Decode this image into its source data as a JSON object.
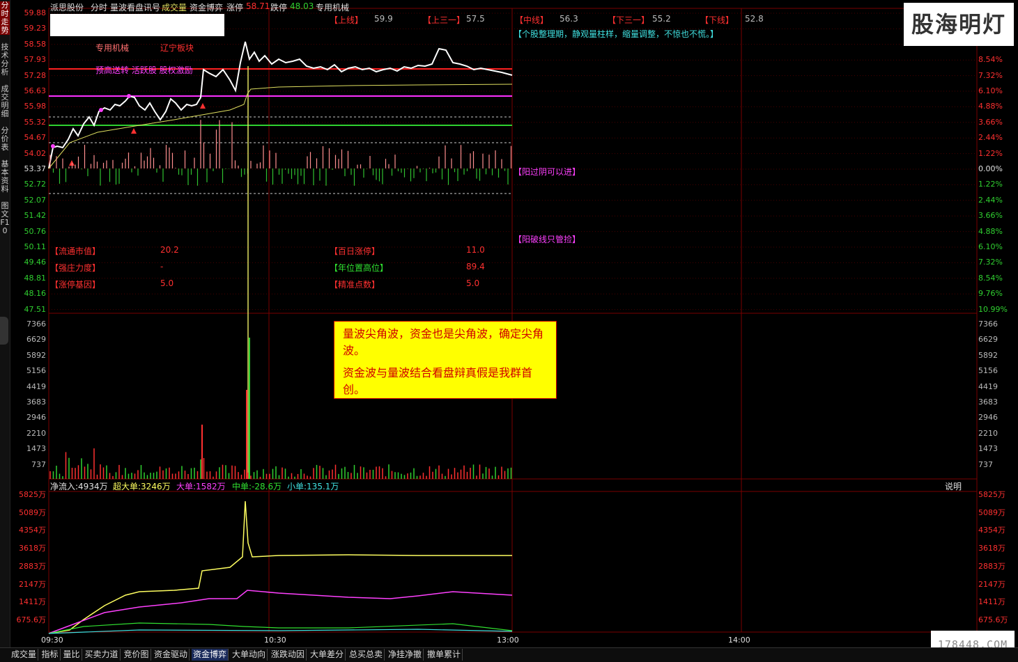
{
  "header": {
    "stock_name": "派思股份",
    "view": "分时",
    "indicator": "量波看盘讯号",
    "vol_label": "成交量",
    "fund_label": "资金博弈",
    "limit_up_label": "涨停",
    "limit_up_value": "58.71",
    "limit_down_label": "跌停",
    "limit_down_value": "48.03",
    "sector": "专用机械"
  },
  "sidebar": [
    "分时走势",
    "技术分析",
    "成交明细",
    "分价表",
    "基本资料",
    "图文F10"
  ],
  "levels": [
    {
      "label": "【上线】",
      "value": "59.9"
    },
    {
      "label": "【上三一】",
      "value": "57.5"
    },
    {
      "label": "【中线】",
      "value": "56.3"
    },
    {
      "label": "【下三一】",
      "value": "55.2"
    },
    {
      "label": "【下线】",
      "value": "52.8"
    }
  ],
  "tags": {
    "sector1": "专用机械",
    "sector2": "辽宁板块",
    "concepts": "预高送转 活跃股 股权激励"
  },
  "comments": {
    "top": "【个股整理期，静观量柱样，缩量调整，不惊也不慌。】",
    "mid1": "【阳过阴可以进】",
    "mid2": "【阳破线只管捡】"
  },
  "stats": [
    {
      "label": "【流通市值】",
      "value": "20.2"
    },
    {
      "label": "【百日涨停】",
      "value": "11.0"
    },
    {
      "label": "【强庄力度】",
      "value": "-"
    },
    {
      "label": "【年位置高位】",
      "value": "89.4"
    },
    {
      "label": "【涨停基因】",
      "value": "5.0"
    },
    {
      "label": "【精准点数】",
      "value": "5.0"
    }
  ],
  "price_axis": {
    "left": [
      "59.88",
      "59.23",
      "58.58",
      "57.93",
      "57.28",
      "56.63",
      "55.98",
      "55.32",
      "54.67",
      "54.02",
      "53.37",
      "52.72",
      "52.07",
      "51.42",
      "50.76",
      "50.11",
      "49.46",
      "48.81",
      "48.16",
      "47.51"
    ],
    "right": [
      "",
      "",
      "",
      "8.54%",
      "7.32%",
      "6.10%",
      "4.88%",
      "3.66%",
      "2.44%",
      "1.22%",
      "0.00%",
      "1.22%",
      "2.44%",
      "3.66%",
      "4.88%",
      "6.10%",
      "7.32%",
      "8.54%",
      "9.76%",
      "10.99%"
    ]
  },
  "volume_axis": [
    "7366",
    "6629",
    "5892",
    "5156",
    "4419",
    "3683",
    "2946",
    "2210",
    "1473",
    "737"
  ],
  "fund_legend": {
    "net": "净流入:4934万",
    "super": "超大单:3246万",
    "large": "大单:1582万",
    "medium": "中单:-28.6万",
    "small": "小单:135.1万",
    "explain": "说明"
  },
  "fund_axis": [
    "5825万",
    "5089万",
    "4354万",
    "3618万",
    "2883万",
    "2147万",
    "1411万",
    "675.6万"
  ],
  "time_axis": [
    "09:30",
    "10:30",
    "13:00",
    "14:00"
  ],
  "note": {
    "line1": "量波尖角波，资金也是尖角波，确定尖角波。",
    "line2": "资金波与量波结合看盘辩真假是我群首创。"
  },
  "tabs": [
    "成交量",
    "指标",
    "量比",
    "买卖力道",
    "竞价图",
    "资金驱动",
    "资金博弈",
    "大单动向",
    "涨跌动因",
    "大单差分",
    "总买总卖",
    "净挂净撤",
    "撤单累计"
  ],
  "active_tab": "资金博弈",
  "colors": {
    "up": "#ff3030",
    "down": "#30d030",
    "price": "#ffffff",
    "avg": "#e0e060",
    "super": "#ffff60",
    "large": "#ff40ff",
    "medium": "#30e030",
    "small": "#40e0e0"
  }
}
